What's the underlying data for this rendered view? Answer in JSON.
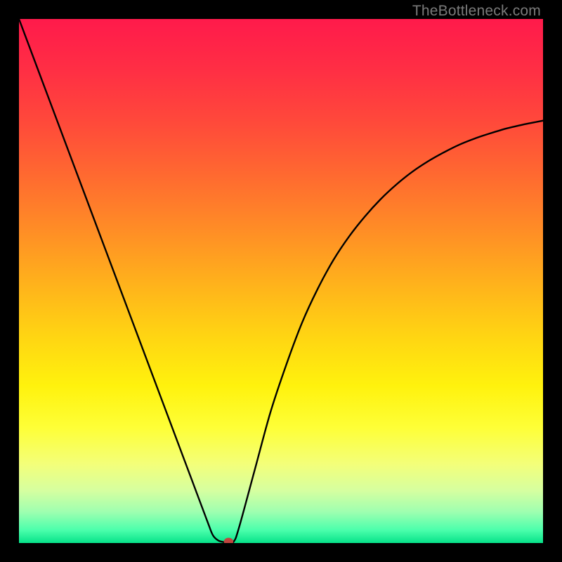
{
  "watermark": "TheBottleneck.com",
  "chart_data": {
    "type": "line",
    "title": "",
    "xlabel": "",
    "ylabel": "",
    "xlim": [
      0,
      100
    ],
    "ylim": [
      0,
      100
    ],
    "grid": false,
    "series": [
      {
        "name": "curve",
        "x": [
          0,
          3,
          6,
          9,
          12,
          15,
          18,
          21,
          24,
          27,
          30,
          33,
          36,
          37,
          38,
          39,
          40,
          41,
          42,
          45,
          48,
          51,
          54,
          57,
          60,
          63,
          66,
          69,
          72,
          75,
          78,
          81,
          84,
          87,
          90,
          93,
          96,
          99,
          100
        ],
        "y": [
          100,
          92,
          84,
          76,
          68,
          60,
          52,
          44,
          36,
          28,
          20,
          12,
          4,
          1.5,
          0.5,
          0.2,
          0.2,
          0.3,
          3,
          14,
          25,
          34,
          42,
          48.5,
          54,
          58.5,
          62.3,
          65.6,
          68.4,
          70.8,
          72.8,
          74.5,
          76,
          77.2,
          78.2,
          79.1,
          79.8,
          80.4,
          80.6
        ]
      }
    ],
    "marker": {
      "x": 40,
      "y": 0.3
    },
    "background_gradient": {
      "stops": [
        {
          "pos": 0.0,
          "color": "#ff1a4b"
        },
        {
          "pos": 0.1,
          "color": "#ff2f44"
        },
        {
          "pos": 0.2,
          "color": "#ff4a3a"
        },
        {
          "pos": 0.3,
          "color": "#ff6a30"
        },
        {
          "pos": 0.4,
          "color": "#ff8c26"
        },
        {
          "pos": 0.5,
          "color": "#ffb01c"
        },
        {
          "pos": 0.6,
          "color": "#ffd313"
        },
        {
          "pos": 0.7,
          "color": "#fff20d"
        },
        {
          "pos": 0.78,
          "color": "#feff37"
        },
        {
          "pos": 0.85,
          "color": "#f3ff7a"
        },
        {
          "pos": 0.9,
          "color": "#d6ffa0"
        },
        {
          "pos": 0.94,
          "color": "#9fffb0"
        },
        {
          "pos": 0.975,
          "color": "#4cffac"
        },
        {
          "pos": 1.0,
          "color": "#06e289"
        }
      ]
    }
  }
}
